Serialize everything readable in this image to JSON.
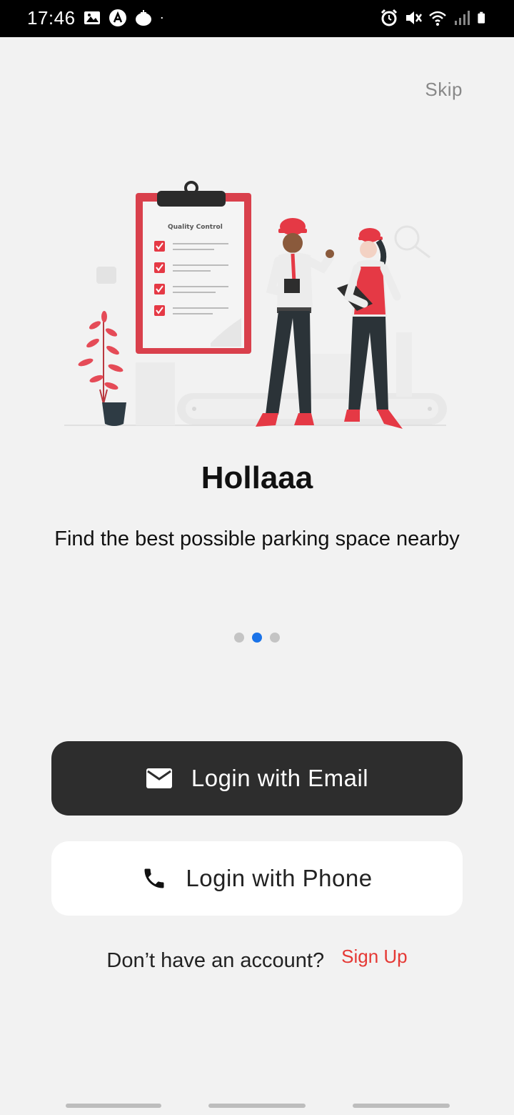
{
  "status_bar": {
    "time": "17:46",
    "left_icons": [
      "image-icon",
      "app-icon",
      "tomato-icon",
      "dot-icon"
    ],
    "right_icons": [
      "alarm-icon",
      "mute-icon",
      "wifi-icon",
      "signal-icon",
      "battery-icon"
    ]
  },
  "onboarding": {
    "skip_label": "Skip",
    "illustration_caption": "Quality Control",
    "title": "Hollaaa",
    "subtitle": "Find the best possible parking space nearby",
    "page_indicator": {
      "count": 3,
      "active_index": 1
    }
  },
  "actions": {
    "email_button_label": "Login with Email",
    "phone_button_label": "Login with Phone",
    "no_account_text": "Don’t have an account?",
    "signup_label": "Sign Up"
  },
  "colors": {
    "accent_red": "#e53935",
    "dark_button": "#2d2d2d",
    "dot_active": "#1a73e8",
    "dot_inactive": "#c4c4c4",
    "background": "#f2f2f2"
  }
}
